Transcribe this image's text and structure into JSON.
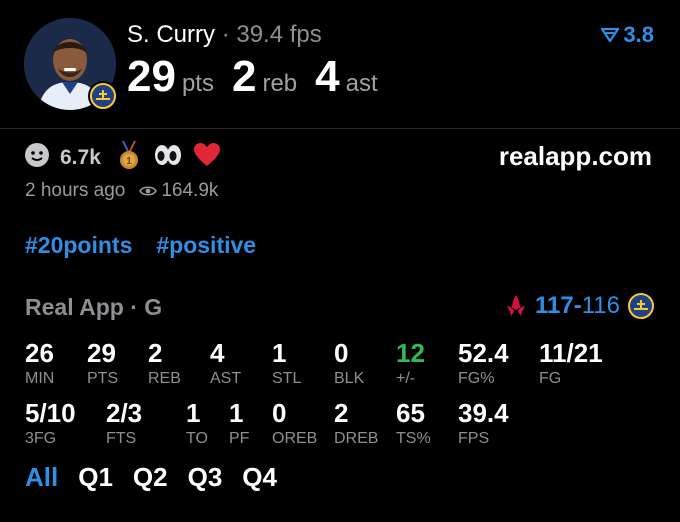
{
  "player": {
    "name": "S. Curry",
    "separator": "·",
    "fps": "39.4 fps",
    "pts": "29",
    "pts_unit": "pts",
    "reb": "2",
    "reb_unit": "reb",
    "ast": "4",
    "ast_unit": "ast"
  },
  "score_badge": {
    "icon": "filter-v-icon",
    "value": "3.8"
  },
  "reactions": {
    "smile_count": "6.7k",
    "icons": [
      "smile-icon",
      "medal-icon",
      "eyes-icon",
      "heart-icon"
    ]
  },
  "site": "realapp.com",
  "meta": {
    "time": "2 hours ago",
    "views": "164.9k"
  },
  "tags": [
    "#20points",
    "#positive"
  ],
  "section": {
    "source": "Real App",
    "separator": "·",
    "position": "G"
  },
  "game": {
    "team_score": "117",
    "dash": "-",
    "opp_score": "116"
  },
  "stats_row1": [
    {
      "value": "26",
      "label": "MIN"
    },
    {
      "value": "29",
      "label": "PTS"
    },
    {
      "value": "2",
      "label": "REB"
    },
    {
      "value": "4",
      "label": "AST"
    },
    {
      "value": "1",
      "label": "STL"
    },
    {
      "value": "0",
      "label": "BLK"
    },
    {
      "value": "12",
      "label": "+/-"
    },
    {
      "value": "52.4",
      "label": "FG%"
    },
    {
      "value": "11/21",
      "label": "FG"
    }
  ],
  "stats_row2": [
    {
      "value": "5/10",
      "label": "3FG"
    },
    {
      "value": "2/3",
      "label": "FTS"
    },
    {
      "value": "1",
      "label": "TO"
    },
    {
      "value": "1",
      "label": "PF"
    },
    {
      "value": "0",
      "label": "OREB"
    },
    {
      "value": "2",
      "label": "DREB"
    },
    {
      "value": "65",
      "label": "TS%"
    },
    {
      "value": "39.4",
      "label": "FPS"
    }
  ],
  "quarters": [
    "All",
    "Q1",
    "Q2",
    "Q3",
    "Q4"
  ],
  "colors": {
    "accent": "#2f8fe8",
    "positive": "#30b955",
    "muted": "#8e8e93"
  }
}
